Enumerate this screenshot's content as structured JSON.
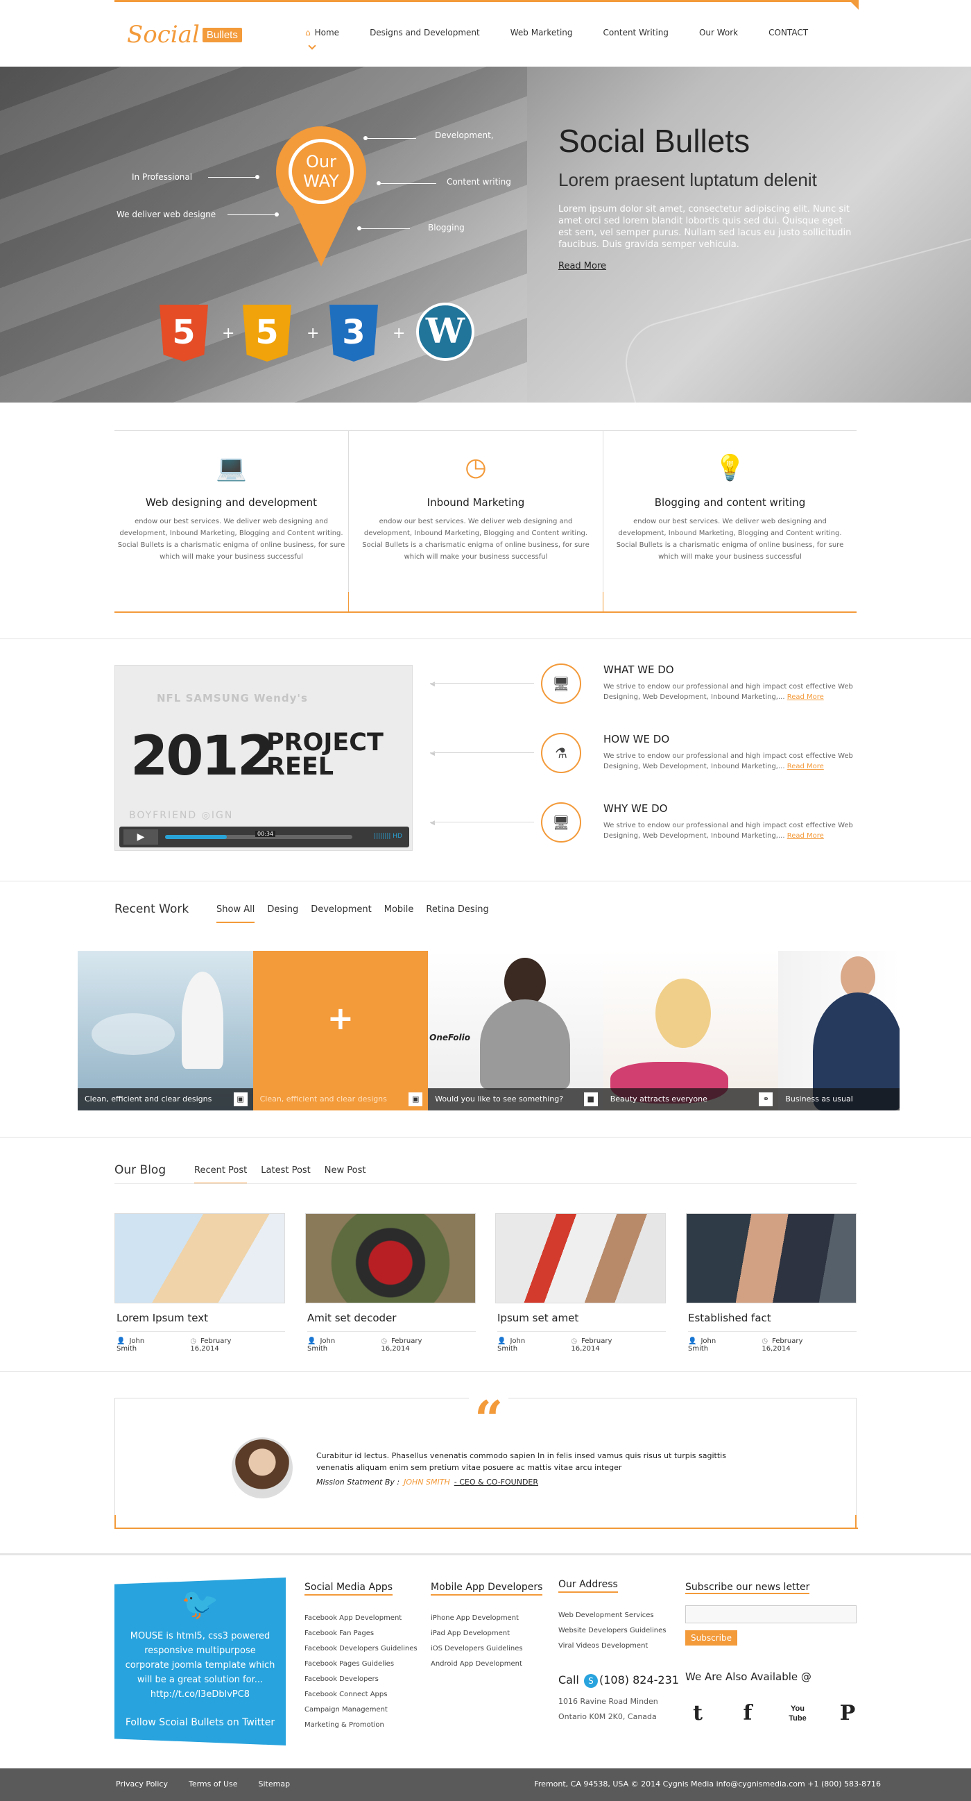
{
  "header": {
    "logo_text": "Social",
    "logo_badge": "Bullets",
    "nav": [
      {
        "label": "Home",
        "active": true
      },
      {
        "label": "Designs and Development"
      },
      {
        "label": "Web Marketing"
      },
      {
        "label": "Content Writing"
      },
      {
        "label": "Our Work"
      },
      {
        "label": "CONTACT"
      }
    ]
  },
  "hero": {
    "pin_line1": "Our",
    "pin_line2": "WAY",
    "labels_left": [
      "In Professional",
      "We deliver web designe"
    ],
    "labels_right": [
      "Development,",
      "Content writing",
      "Blogging"
    ],
    "badges": [
      "5",
      "5",
      "3"
    ],
    "wordpress_glyph": "W",
    "title": "Social Bullets",
    "subtitle": "Lorem praesent luptatum delenit",
    "body": "Lorem ipsum dolor sit amet, consectetur adipiscing elit. Nunc sit amet orci sed lorem blandit lobortis quis sed dui. Quisque eget est sem, vel semper purus. Nullam sed lacus eu justo sollicitudin faucibus. Duis gravida semper vehicula.",
    "read_more": "Read More",
    "colors": {
      "accent": "#f39a3a",
      "html5": "#e44d26",
      "js": "#f0a30a",
      "css3": "#1f6fbf",
      "wordpress": "#21759b"
    }
  },
  "services": [
    {
      "icon": "laptop-icon",
      "title": "Web designing and development",
      "text": "endow our best services. We deliver web designing and development, Inbound Marketing, Blogging and Content writing. Social Bullets is a charismatic enigma of online business, for sure which will make your business successful"
    },
    {
      "icon": "timer-icon",
      "title": "Inbound Marketing",
      "text": "endow our best services. We deliver web designing and development, Inbound Marketing, Blogging and Content writing. Social Bullets is a charismatic enigma of online business, for sure which will make your business successful"
    },
    {
      "icon": "bulb-icon",
      "title": "Blogging and content writing",
      "text": "endow our best services. We deliver web designing and development, Inbound Marketing, Blogging and Content writing. Social Bullets is a charismatic enigma of online business, for sure which will make your business successful"
    }
  ],
  "video": {
    "logos": "NFL   SAMSUNG   Wendy's",
    "year": "2012",
    "reel_1": "PROJECT",
    "reel_2": "REEL",
    "bottom_logos": "BOYFRIEND   ◎IGN",
    "time": "00:34",
    "hd": "|||||||| HD",
    "progress": 0.33
  },
  "features": [
    {
      "title": "WHAT WE DO",
      "text": "We strive to endow our professional and high impact cost effective Web Designing, Web Development, Inbound Marketing,...",
      "more": "Read More"
    },
    {
      "title": "HOW WE DO",
      "text": "We strive to endow our professional and high impact cost effective Web Designing, Web Development, Inbound Marketing,...",
      "more": "Read More"
    },
    {
      "title": "WHY WE DO",
      "text": "We strive to endow our professional and high impact cost effective Web Designing, Web Development, Inbound Marketing,...",
      "more": "Read More"
    }
  ],
  "recent_work": {
    "title": "Recent Work",
    "tabs": [
      "Show All",
      "Desing",
      "Development",
      "Mobile",
      "Retina Desing"
    ],
    "items": [
      {
        "caption": "Clean, efficient and clear designs"
      },
      {
        "caption": "Clean, efficient and clear designs",
        "plus": "+"
      },
      {
        "caption": "Would you like to see something?",
        "brand": "OneFolio"
      },
      {
        "caption": "Beauty attracts everyone"
      },
      {
        "caption": "Business as usual"
      }
    ]
  },
  "blog": {
    "title": "Our Blog",
    "tabs": [
      "Recent Post",
      "Latest Post",
      "New Post"
    ],
    "posts": [
      {
        "title": "Lorem Ipsum text",
        "author": "John Smith",
        "date": "February 16,2014"
      },
      {
        "title": "Amit set decoder",
        "author": "John Smith",
        "date": "February 16,2014"
      },
      {
        "title": "Ipsum set amet",
        "author": "John Smith",
        "date": "February 16,2014"
      },
      {
        "title": "Established fact",
        "author": "John Smith",
        "date": "February 16,2014"
      }
    ]
  },
  "testimonial": {
    "quote_mark": "“",
    "text": "Curabitur id lectus. Phasellus venenatis commodo sapien In in felis insed vamus quis risus ut turpis sagittis venenatis aliquam enim sem pretium vitae posuere ac mattis vitae arcu integer",
    "by_label": "Mission Statment By :",
    "name": "JOHN SMITH",
    "role": "- CEO & CO-FOUNDER"
  },
  "footer": {
    "twitter": {
      "text": "MOUSE is html5, css3 powered responsive multipurpose corporate joomla template which will be a great solution for... http://t.co/l3eDblvPC8",
      "follow": "Follow Scoial Bullets on Twitter"
    },
    "social_apps": {
      "title": "Social Media Apps",
      "items": [
        "Facebook App Development",
        "Facebook Fan Pages",
        "Facebook Developers Guidelines",
        "Facebook Pages Guidelies",
        "Facebook Developers",
        "Facebook Connect Apps",
        "Campaign Management",
        "Marketing & Promotion"
      ]
    },
    "mobile_apps": {
      "title": "Mobile App Developers",
      "items": [
        "iPhone App Development",
        "iPad App Development",
        "iOS Developers Guidelines",
        "Android App Development"
      ]
    },
    "address": {
      "title": "Our Address",
      "items": [
        "Web Development Services",
        "Website Developers Guidelines",
        "Viral Videos Development"
      ],
      "call_label": "Call",
      "phone": "(108) 824-231",
      "street": "1016 Ravine Road Minden",
      "city": "Ontario K0M 2K0, Canada"
    },
    "subscribe": {
      "title": "Subscribe our news letter",
      "placeholder": "",
      "button": "Subscribe"
    },
    "available": "We Are Also Available @",
    "social_icons": [
      "twitter-icon",
      "facebook-icon",
      "youtube-icon",
      "pinterest-icon"
    ]
  },
  "bottom_bar": {
    "links": [
      "Privacy Policy",
      "Terms of Use",
      "Sitemap"
    ],
    "copyright": "Fremont, CA 94538, USA © 2014 Cygnis Media info@cygnismedia.com +1 (800) 583-8716"
  }
}
